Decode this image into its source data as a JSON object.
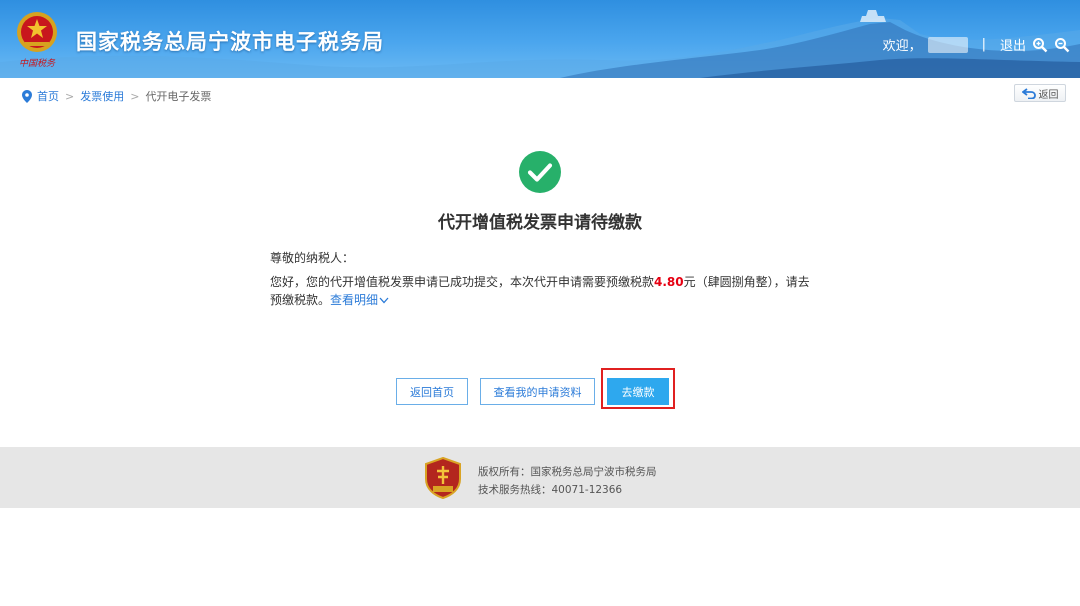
{
  "header": {
    "site_title": "国家税务总局宁波市电子税务局",
    "welcome_label": "欢迎，",
    "divider": "|",
    "logout_label": "退出",
    "emblem_caption": "中国税务",
    "icons": [
      "zoom-in-icon",
      "zoom-out-icon"
    ]
  },
  "breadcrumb": {
    "items": [
      "首页",
      "发票使用",
      "代开电子发票"
    ],
    "separator": ">"
  },
  "back_button": {
    "label": "返回"
  },
  "result": {
    "title": "代开增值税发票申请待缴款",
    "greeting": "尊敬的纳税人：",
    "message_before": "您好，您的代开增值税发票申请已成功提交，本次代开申请需要预缴税款",
    "amount": "4.80",
    "message_after": "元（肆圆捌角整），请去预缴税款。",
    "detail_link": "查看明细"
  },
  "buttons": {
    "home": "返回首页",
    "records": "查看我的申请资料",
    "pay": "去缴款"
  },
  "footer": {
    "copyright": "版权所有：国家税务总局宁波市税务局",
    "hotline": "技术服务热线：40071-12366"
  },
  "colors": {
    "header_blue": "#3d9be8",
    "success_green": "#27b06a",
    "link_blue": "#2b7bd8",
    "pay_button": "#2ea8ee",
    "amount_red": "#e60012",
    "highlight_red": "#e02020"
  }
}
